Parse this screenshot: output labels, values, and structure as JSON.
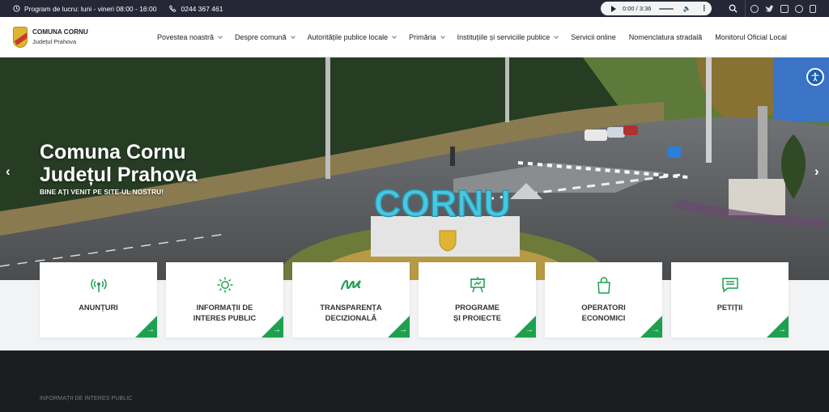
{
  "topbar": {
    "schedule": "Program de lucru: luni - vineri 08:00 - 16:00",
    "phone": "0244 367 461",
    "audio_time": "0:00 / 3:36"
  },
  "header": {
    "site_name": "COMUNA CORNU",
    "site_county": "Județul Prahova"
  },
  "menu": [
    {
      "label": "Povestea noastră",
      "dropdown": true
    },
    {
      "label": "Despre comună",
      "dropdown": true
    },
    {
      "label": "Autoritățile publice locale",
      "dropdown": true
    },
    {
      "label": "Primăria",
      "dropdown": true
    },
    {
      "label": "Instituțiile și serviciile publice",
      "dropdown": true
    },
    {
      "label": "Servicii online",
      "dropdown": false
    },
    {
      "label": "Nomenclatura stradală",
      "dropdown": false
    },
    {
      "label": "Monitorul Oficial Local",
      "dropdown": false
    }
  ],
  "hero": {
    "title_line1": "Comuna Cornu",
    "title_line2": "Județul Prahova",
    "subtitle": "BINE AȚI VENIT PE SITE-UL NOSTRU!",
    "sign_text": "CORNU"
  },
  "cards": [
    {
      "line1": "ANUNȚURI",
      "line2": "",
      "icon": "broadcast-icon"
    },
    {
      "line1": "INFORMAȚII DE",
      "line2": "INTERES PUBLIC",
      "icon": "sun-icon"
    },
    {
      "line1": "TRANSPARENȚA",
      "line2": "DECIZIONALĂ",
      "icon": "signature-icon"
    },
    {
      "line1": "PROGRAME",
      "line2": "ȘI PROIECTE",
      "icon": "presentation-board-icon"
    },
    {
      "line1": "OPERATORI",
      "line2": "ECONOMICI",
      "icon": "shopping-bag-icon"
    },
    {
      "line1": "PETIȚII",
      "line2": "",
      "icon": "message-icon"
    }
  ],
  "section": {
    "label": "INFORMAȚII DE INTERES PUBLIC"
  },
  "colors": {
    "accent_green": "#1da150",
    "topbar_bg": "#262736",
    "dark_section": "#1c1d20"
  }
}
